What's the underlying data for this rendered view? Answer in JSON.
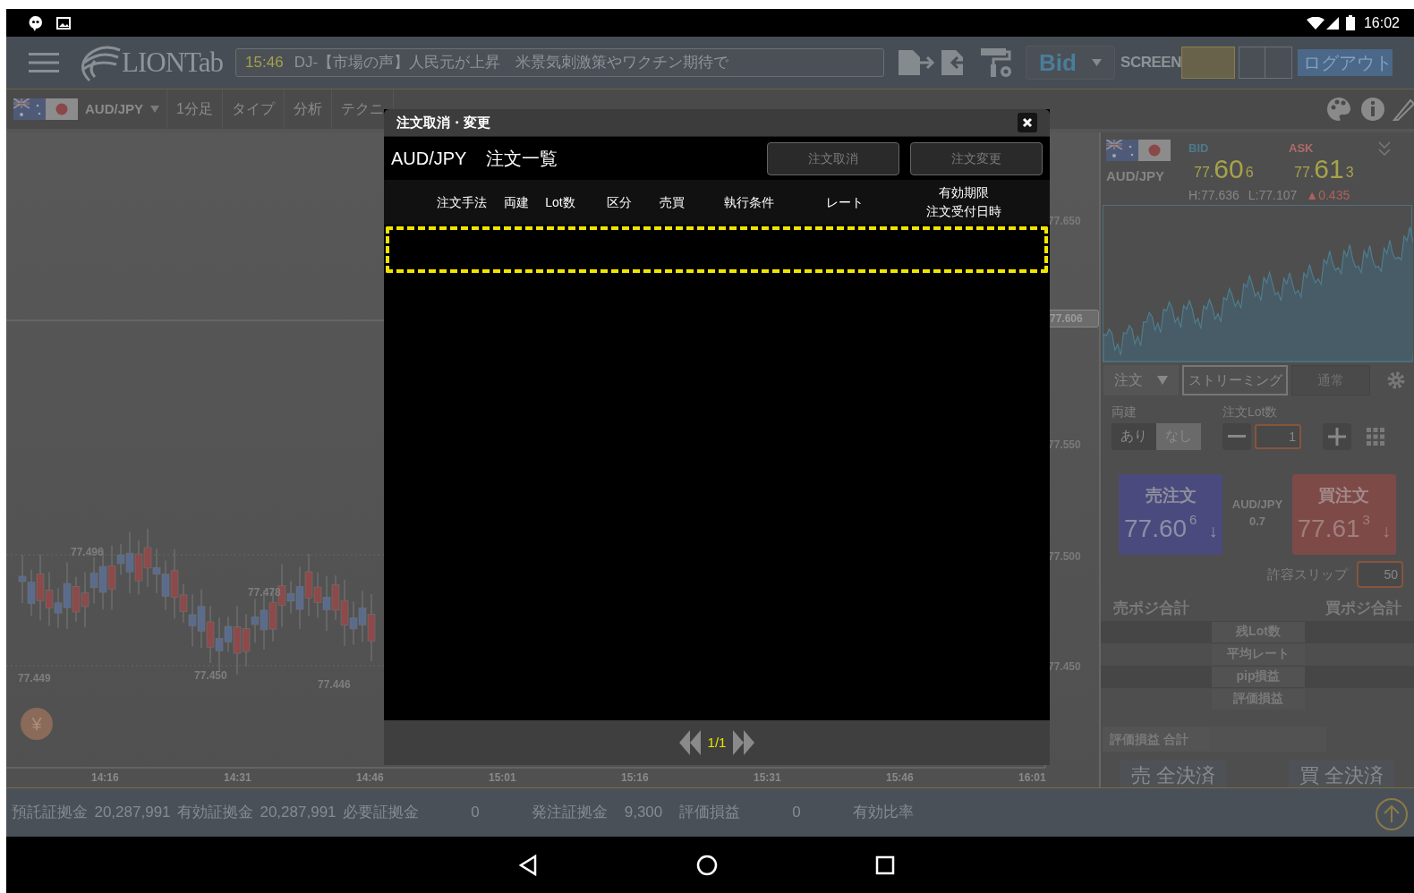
{
  "status_bar": {
    "time": "16:02"
  },
  "header": {
    "logo": "LIONTab",
    "news_time": "15:46",
    "news_text": "DJ-【市場の声】人民元が上昇　米景気刺激策やワクチン期待で",
    "price_type": "Bid",
    "screen_label": "SCREEN",
    "logout": "ログアウト"
  },
  "toolbar": {
    "pair": "AUD/JPY",
    "items": [
      "1分足",
      "タイプ",
      "分析",
      "テクニ"
    ]
  },
  "chart": {
    "y_labels": [
      "77.650",
      "77.550",
      "77.500",
      "77.450"
    ],
    "current_price": "77.606",
    "x_labels": [
      "14:16",
      "14:31",
      "14:46",
      "15:01",
      "15:16",
      "15:31",
      "15:46",
      "16:01"
    ],
    "annotations": [
      "77.496",
      "77.478",
      "77.449",
      "77.450",
      "77.446"
    ],
    "currency_symbol": "¥"
  },
  "quote": {
    "pair": "AUD/JPY",
    "bid_label": "BID",
    "bid_head": "77.",
    "bid_main": "60",
    "bid_tail": "6",
    "ask_label": "ASK",
    "ask_head": "77.",
    "ask_main": "61",
    "ask_tail": "3",
    "high": "H:77.636",
    "low": "L:77.107",
    "change": "▲0.435"
  },
  "order_controls": {
    "order_type": "注文",
    "modes": [
      {
        "label": "ストリーミング",
        "selected": true
      },
      {
        "label": "通常",
        "selected": false
      }
    ],
    "hedge_label": "両建",
    "hedge_options": [
      {
        "label": "あり",
        "selected": false
      },
      {
        "label": "なし",
        "selected": true
      }
    ],
    "lot_label": "注文Lot数",
    "lot_value": "1"
  },
  "trade": {
    "sell": {
      "title": "売注文",
      "price": "77.60",
      "pip": "6",
      "arrow": "↓"
    },
    "pair": "AUD/JPY",
    "spread": "0.7",
    "buy": {
      "title": "買注文",
      "price": "77.61",
      "pip": "3",
      "arrow": "↓"
    }
  },
  "slip": {
    "label": "許容スリップ",
    "value": "50"
  },
  "positions": {
    "sell_title": "売ポジ合計",
    "buy_title": "買ポジ合計",
    "rows": [
      "残Lot数",
      "平均レート",
      "pip損益",
      "評価損益"
    ],
    "total_label": "評価損益 合計",
    "close_sell": "売 全決済",
    "close_buy": "買 全決済"
  },
  "account_bar": [
    {
      "label": "預託証拠金",
      "value": "20,287,991"
    },
    {
      "label": "有効証拠金",
      "value": "20,287,991"
    },
    {
      "label": "必要証拠金",
      "value": "0"
    },
    {
      "label": "発注証拠金",
      "value": "9,300"
    },
    {
      "label": "評価損益",
      "value": "0"
    },
    {
      "label": "有効比率"
    }
  ],
  "modal": {
    "title": "注文取消・変更",
    "pair": "AUD/JPY",
    "heading": "注文一覧",
    "buttons": [
      "注文取消",
      "注文変更"
    ],
    "columns": [
      {
        "label": "注文手法"
      },
      {
        "label": "両建"
      },
      {
        "label": "Lot数"
      },
      {
        "label": "区分"
      },
      {
        "label": "売買"
      },
      {
        "label": "執行条件"
      },
      {
        "label": "レート"
      },
      {
        "label": "有効期限",
        "sub": "注文受付日時"
      }
    ],
    "page": "1/1"
  }
}
